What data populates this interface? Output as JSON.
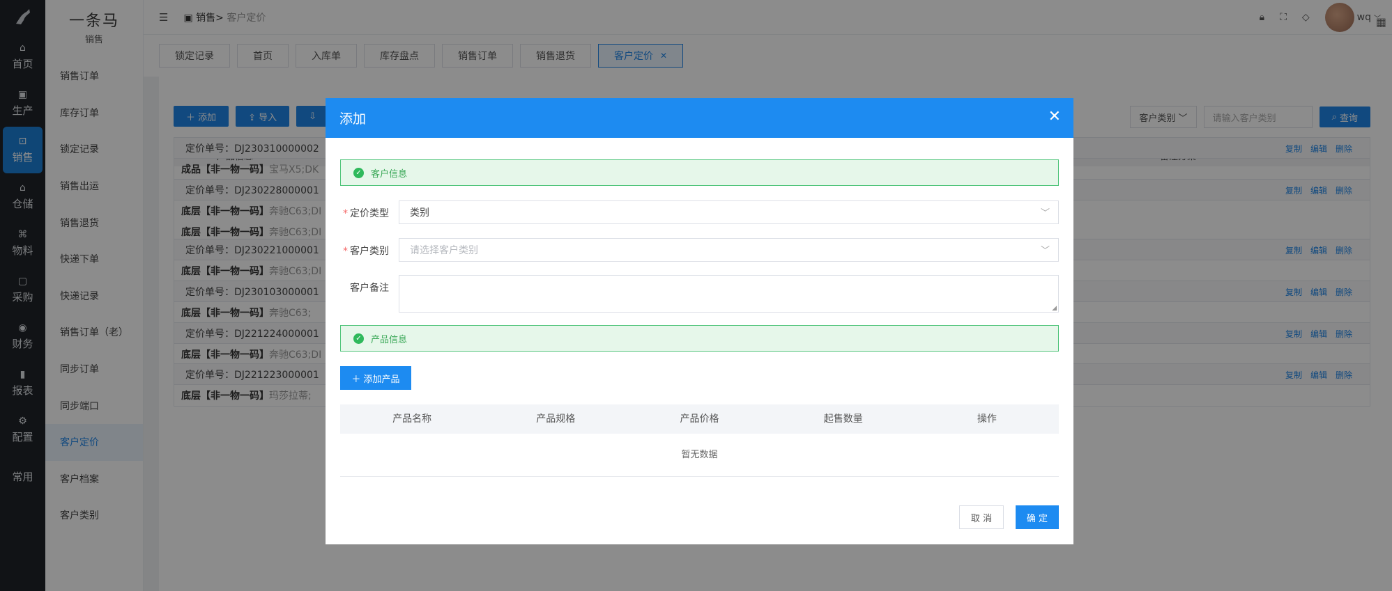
{
  "rail": {
    "items": [
      {
        "icon": "home-icon",
        "glyph": "⌂",
        "label": "首页"
      },
      {
        "icon": "factory-icon",
        "glyph": "▣",
        "label": "生产"
      },
      {
        "icon": "sales-icon",
        "glyph": "⊡",
        "label": "销售"
      },
      {
        "icon": "warehouse-icon",
        "glyph": "⌂",
        "label": "仓储"
      },
      {
        "icon": "material-icon",
        "glyph": "⌘",
        "label": "物料"
      },
      {
        "icon": "purchase-icon",
        "glyph": "▢",
        "label": "采购"
      },
      {
        "icon": "finance-icon",
        "glyph": "◉",
        "label": "财务"
      },
      {
        "icon": "report-icon",
        "glyph": "▮",
        "label": "报表"
      },
      {
        "icon": "config-icon",
        "glyph": "⚙",
        "label": "配置"
      },
      {
        "icon": "",
        "glyph": "",
        "label": "常用"
      }
    ]
  },
  "side": {
    "brand": "一条马",
    "sub": "销售",
    "menu": [
      "销售订单",
      "库存订单",
      "锁定记录",
      "销售出运",
      "销售退货",
      "快递下单",
      "快递记录",
      "销售订单（老）",
      "同步订单",
      "同步端口",
      "客户定价",
      "客户档案",
      "客户类别"
    ]
  },
  "topbar": {
    "crumb_parent": "销售>",
    "crumb_current": "客户定价",
    "user": "wq"
  },
  "tabs": [
    "锁定记录",
    "首页",
    "入库单",
    "库存盘点",
    "销售订单",
    "销售退货",
    "客户定价"
  ],
  "main": {
    "buttons": [
      "＋ 添加",
      "⇪ 导入",
      "⇩"
    ],
    "filter_select": "客户类别",
    "filter_placeholder": "请输入客户类别",
    "query": "查询",
    "col_product": "产品信息",
    "col_note": "备注方案",
    "ops": [
      "复制",
      "编辑",
      "删除"
    ],
    "records": [
      {
        "no": "定价单号：DJ230310000002",
        "lines": [
          {
            "b": "成品【非一物一码】",
            "g": "宝马X5;DK"
          }
        ]
      },
      {
        "no": "定价单号：DJ230228000001",
        "lines": [
          {
            "b": "底层【非一物一码】",
            "g": "奔驰C63;DI"
          },
          {
            "b": "底层【非一物一码】",
            "g": "奔驰C63;DI"
          }
        ]
      },
      {
        "no": "定价单号：DJ230221000001",
        "lines": [
          {
            "b": "底层【非一物一码】",
            "g": "奔驰C63;DI"
          }
        ]
      },
      {
        "no": "定价单号：DJ230103000001",
        "lines": [
          {
            "b": "底层【非一物一码】",
            "g": "奔驰C63;"
          }
        ]
      },
      {
        "no": "定价单号：DJ221224000001",
        "lines": [
          {
            "b": "底层【非一物一码】",
            "g": "奔驰C63;DI"
          }
        ]
      },
      {
        "no": "定价单号：DJ221223000001",
        "lines": [
          {
            "b": "底层【非一物一码】",
            "g": "玛莎拉蒂;"
          }
        ]
      }
    ]
  },
  "modal": {
    "title": "添加",
    "section_customer": "客户信息",
    "section_product": "产品信息",
    "pricing_type_label": "定价类型",
    "pricing_type_value": "类别",
    "customer_category_label": "客户类别",
    "customer_category_placeholder": "请选择客户类别",
    "customer_note_label": "客户备注",
    "add_product": "＋ 添加产品",
    "columns": [
      "产品名称",
      "产品规格",
      "产品价格",
      "起售数量",
      "操作"
    ],
    "empty": "暂无数据",
    "cancel": "取 消",
    "ok": "确 定"
  }
}
